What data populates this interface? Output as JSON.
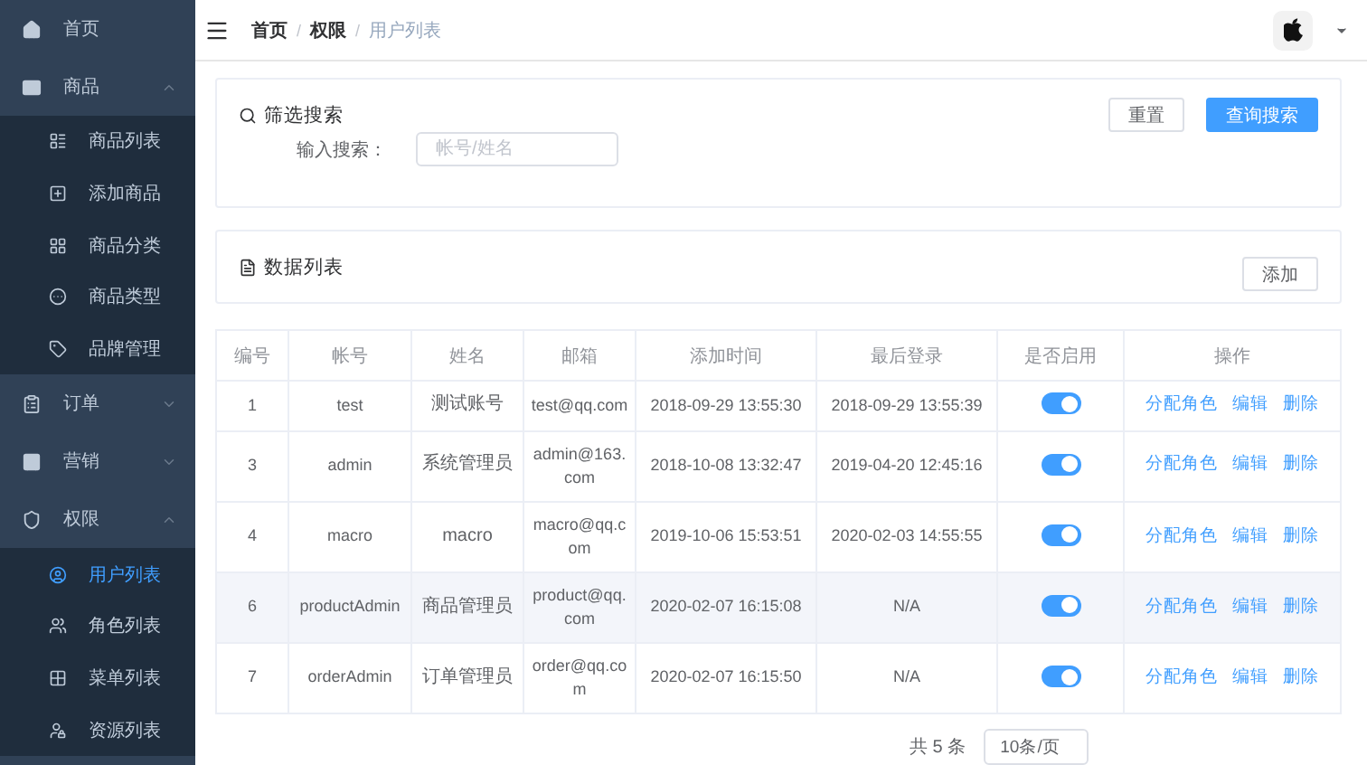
{
  "sidebar": {
    "items": [
      {
        "label": "首页",
        "selected": false
      },
      {
        "label": "商品",
        "expanded": true,
        "selected": false,
        "children": [
          {
            "label": "商品列表",
            "selected": false
          },
          {
            "label": "添加商品",
            "selected": false
          },
          {
            "label": "商品分类",
            "selected": false
          },
          {
            "label": "商品类型",
            "selected": false
          },
          {
            "label": "品牌管理",
            "selected": false
          }
        ]
      },
      {
        "label": "订单",
        "expanded": false,
        "selected": false
      },
      {
        "label": "营销",
        "expanded": false,
        "selected": false
      },
      {
        "label": "权限",
        "expanded": true,
        "selected": false,
        "children": [
          {
            "label": "用户列表",
            "selected": true
          },
          {
            "label": "角色列表",
            "selected": false
          },
          {
            "label": "菜单列表",
            "selected": false
          },
          {
            "label": "资源列表",
            "selected": false
          }
        ]
      }
    ]
  },
  "breadcrumb": [
    "首页",
    "权限",
    "用户列表"
  ],
  "breadcrumb_separator": "/",
  "filter": {
    "title": "筛选搜索",
    "reset_button": "重置",
    "search_button": "查询搜索",
    "field_label": "输入搜索：",
    "placeholder": "帐号/姓名"
  },
  "list_card": {
    "title": "数据列表",
    "add_button": "添加"
  },
  "table": {
    "columns": [
      "编号",
      "帐号",
      "姓名",
      "邮箱",
      "添加时间",
      "最后登录",
      "是否启用",
      "操作"
    ],
    "rows": [
      {
        "cells": [
          "1",
          "test",
          "测试账号",
          "test@qq.com",
          "2018-09-29 13:55:30",
          "2018-09-29 13:55:39"
        ],
        "on": true,
        "hovered": false,
        "actions": [
          "分配角色",
          "编辑",
          "删除"
        ]
      },
      {
        "cells": [
          "3",
          "admin",
          "系统管理员",
          "admin@163.com",
          "2018-10-08 13:32:47",
          "2019-04-20 12:45:16"
        ],
        "on": true,
        "hovered": false,
        "actions": [
          "分配角色",
          "编辑",
          "删除"
        ]
      },
      {
        "cells": [
          "4",
          "macro",
          "macro",
          "macro@qq.com",
          "2019-10-06 15:53:51",
          "2020-02-03 14:55:55"
        ],
        "on": true,
        "hovered": false,
        "actions": [
          "分配角色",
          "编辑",
          "删除"
        ]
      },
      {
        "cells": [
          "6",
          "productAdmin",
          "商品管理员",
          "product@qq.com",
          "2020-02-07 16:15:08",
          "N/A"
        ],
        "on": true,
        "hovered": true,
        "actions": [
          "分配角色",
          "编辑",
          "删除"
        ]
      },
      {
        "cells": [
          "7",
          "orderAdmin",
          "订单管理员",
          "order@qq.com",
          "2020-02-07 16:15:50",
          "N/A"
        ],
        "on": true,
        "hovered": false,
        "actions": [
          "分配角色",
          "编辑",
          "删除"
        ]
      }
    ]
  },
  "pagination": {
    "total": "共 5 条",
    "page_size": "10条/页"
  }
}
